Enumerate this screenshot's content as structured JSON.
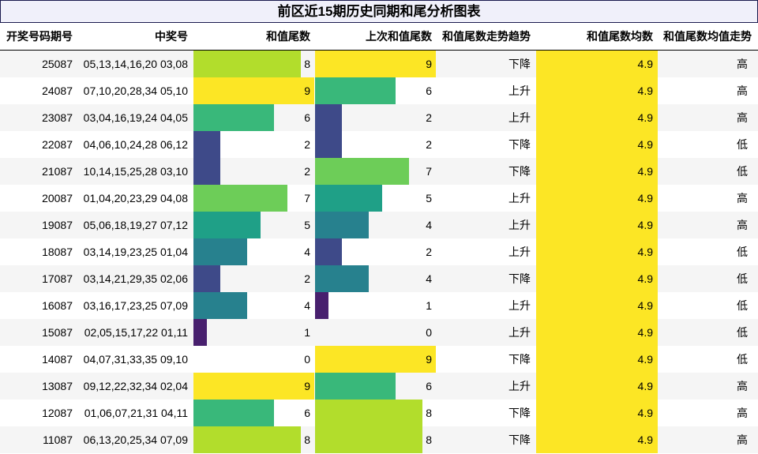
{
  "title": "前区近15期历史同期和尾分析图表",
  "colors": {
    "0": "#ffffff",
    "1": "#48206e",
    "2": "#3e4a89",
    "3": "#32648e",
    "4": "#27818e",
    "5": "#1fa087",
    "6": "#39b87a",
    "7": "#6dcd58",
    "8": "#b2dd2c",
    "9": "#fce625",
    "avg_fill": "#fce625",
    "row_alt": "#f5f5f5"
  },
  "chart_data": {
    "type": "table",
    "columns": [
      "开奖号码期号",
      "中奖号",
      "和值尾数",
      "上次和值尾数",
      "和值尾数走势趋势",
      "和值尾数均数",
      "和值尾数均值走势"
    ],
    "rows": [
      {
        "period": "25087",
        "numbers": "05,13,14,16,20 03,08",
        "tail": 8,
        "prev_tail": 9,
        "trend": "下降",
        "avg": "4.9",
        "avg_trend": "高"
      },
      {
        "period": "24087",
        "numbers": "07,10,20,28,34 05,10",
        "tail": 9,
        "prev_tail": 6,
        "trend": "上升",
        "avg": "4.9",
        "avg_trend": "高"
      },
      {
        "period": "23087",
        "numbers": "03,04,16,19,24 04,05",
        "tail": 6,
        "prev_tail": 2,
        "trend": "上升",
        "avg": "4.9",
        "avg_trend": "高"
      },
      {
        "period": "22087",
        "numbers": "04,06,10,24,28 06,12",
        "tail": 2,
        "prev_tail": 2,
        "trend": "下降",
        "avg": "4.9",
        "avg_trend": "低"
      },
      {
        "period": "21087",
        "numbers": "10,14,15,25,28 03,10",
        "tail": 2,
        "prev_tail": 7,
        "trend": "下降",
        "avg": "4.9",
        "avg_trend": "低"
      },
      {
        "period": "20087",
        "numbers": "01,04,20,23,29 04,08",
        "tail": 7,
        "prev_tail": 5,
        "trend": "上升",
        "avg": "4.9",
        "avg_trend": "高"
      },
      {
        "period": "19087",
        "numbers": "05,06,18,19,27 07,12",
        "tail": 5,
        "prev_tail": 4,
        "trend": "上升",
        "avg": "4.9",
        "avg_trend": "高"
      },
      {
        "period": "18087",
        "numbers": "03,14,19,23,25 01,04",
        "tail": 4,
        "prev_tail": 2,
        "trend": "上升",
        "avg": "4.9",
        "avg_trend": "低"
      },
      {
        "period": "17087",
        "numbers": "03,14,21,29,35 02,06",
        "tail": 2,
        "prev_tail": 4,
        "trend": "下降",
        "avg": "4.9",
        "avg_trend": "低"
      },
      {
        "period": "16087",
        "numbers": "03,16,17,23,25 07,09",
        "tail": 4,
        "prev_tail": 1,
        "trend": "上升",
        "avg": "4.9",
        "avg_trend": "低"
      },
      {
        "period": "15087",
        "numbers": "02,05,15,17,22 01,11",
        "tail": 1,
        "prev_tail": 0,
        "trend": "上升",
        "avg": "4.9",
        "avg_trend": "低"
      },
      {
        "period": "14087",
        "numbers": "04,07,31,33,35 09,10",
        "tail": 0,
        "prev_tail": 9,
        "trend": "下降",
        "avg": "4.9",
        "avg_trend": "低"
      },
      {
        "period": "13087",
        "numbers": "09,12,22,32,34 02,04",
        "tail": 9,
        "prev_tail": 6,
        "trend": "上升",
        "avg": "4.9",
        "avg_trend": "高"
      },
      {
        "period": "12087",
        "numbers": "01,06,07,21,31 04,11",
        "tail": 6,
        "prev_tail": 8,
        "trend": "下降",
        "avg": "4.9",
        "avg_trend": "高"
      },
      {
        "period": "11087",
        "numbers": "06,13,20,25,34 07,09",
        "tail": 8,
        "prev_tail": 8,
        "trend": "下降",
        "avg": "4.9",
        "avg_trend": "高"
      }
    ]
  }
}
